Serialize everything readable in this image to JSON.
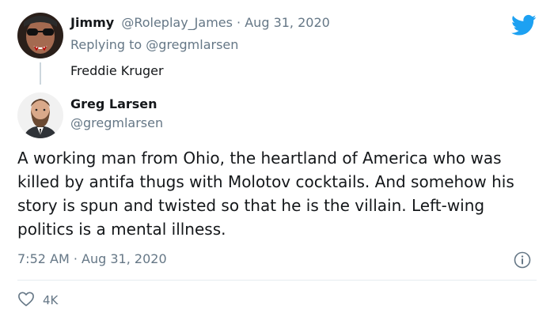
{
  "reply_tweet": {
    "display_name": "Jimmy",
    "handle": "@Roleplay_James",
    "separator": "·",
    "date": "Aug 31, 2020",
    "replying_to_prefix": "Replying to",
    "replying_to_handle": "@gregmlarsen",
    "text": "Freddie Kruger"
  },
  "quoted_tweet": {
    "display_name": "Greg Larsen",
    "handle": "@gregmlarsen",
    "text": "A working man from Ohio, the heartland of America who was killed by antifa thugs with Molotov cocktails. And somehow his story is spun and twisted so that he is the villain. Left-wing politics is a mental illness.",
    "time": "7:52 AM",
    "separator": "·",
    "date": "Aug 31, 2020",
    "likes": "4K"
  },
  "icons": {
    "brand": "twitter-bird-icon",
    "info": "info-icon",
    "like": "heart-icon"
  },
  "colors": {
    "twitter_blue": "#1da1f2",
    "muted_text": "#657786",
    "primary_text": "#14171a",
    "divider": "#e6ecf0"
  }
}
